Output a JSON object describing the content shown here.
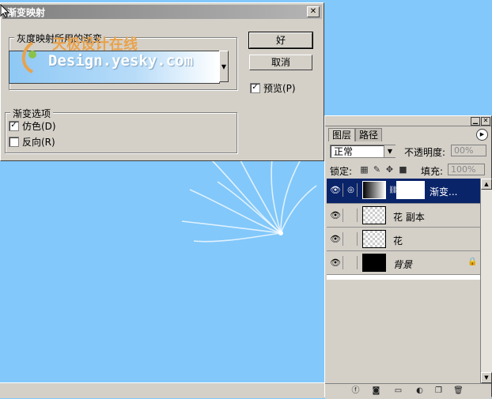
{
  "dialog": {
    "title": "渐变映射",
    "close_glyph": "✕",
    "group_gradient_label": "灰度映射所用的渐变",
    "group_options_label": "渐变选项",
    "ok_label": "好",
    "cancel_label": "取消",
    "preview_label": "预览(P)",
    "preview_checked": true,
    "dither_label": "仿色(D)",
    "dither_checked": true,
    "reverse_label": "反向(R)",
    "reverse_checked": false,
    "watermark_cn": "天极设计在线",
    "watermark_en": "Design.yesky.com",
    "gradient_colors": [
      "#8ec8f5",
      "#b8dcf8",
      "#ffffff"
    ]
  },
  "layers_panel": {
    "tabs": [
      "图层",
      "路径"
    ],
    "blend_mode": "正常",
    "opacity_label": "不透明度:",
    "opacity_value": "00%",
    "lock_label": "锁定:",
    "fill_label": "填充:",
    "fill_value": "100%",
    "layers": [
      {
        "name": "渐变...",
        "selected": true,
        "type": "adjustment"
      },
      {
        "name": "花 副本",
        "selected": false,
        "type": "transparent"
      },
      {
        "name": "花",
        "selected": false,
        "type": "transparent"
      },
      {
        "name": "背景",
        "selected": false,
        "type": "black",
        "locked": true
      }
    ]
  },
  "canvas": {
    "background_color": "#82c8fa"
  }
}
